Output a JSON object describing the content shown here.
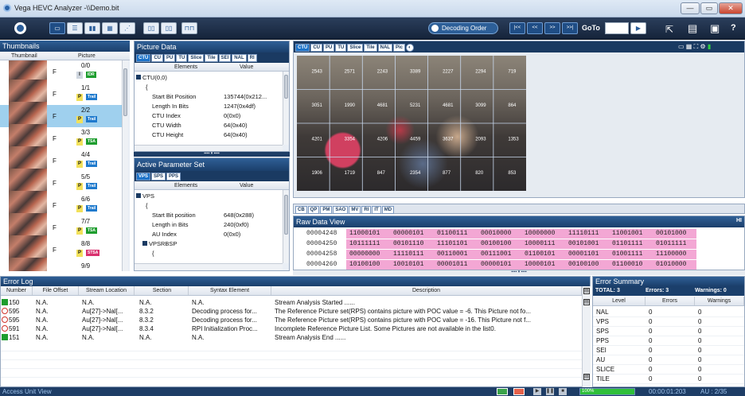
{
  "window": {
    "title": "Vega HEVC Analyzer -\\\\Demo.bit"
  },
  "toolbar": {
    "decoding_order": "Decoding Order",
    "nav": [
      "|<<",
      "<<",
      ">>",
      ">>|"
    ],
    "goto_label": "GoTo",
    "goto_value": ""
  },
  "thumbnails": {
    "title": "Thumbnails",
    "col_thumbnail": "Thumbnail",
    "col_picture": "Picture",
    "items": [
      {
        "type": "F",
        "poc": "0/0",
        "ptype": "I",
        "badge": "IDR",
        "badge_color": "#1e9d2e"
      },
      {
        "type": "F",
        "poc": "1/1",
        "ptype": "P",
        "badge": "Trail",
        "badge_color": "#1f7acd"
      },
      {
        "type": "F",
        "poc": "2/2",
        "ptype": "P",
        "badge": "Trail",
        "badge_color": "#1f7acd"
      },
      {
        "type": "F",
        "poc": "3/3",
        "ptype": "P",
        "badge": "TSA",
        "badge_color": "#1e9d2e"
      },
      {
        "type": "F",
        "poc": "4/4",
        "ptype": "P",
        "badge": "Trail",
        "badge_color": "#1f7acd"
      },
      {
        "type": "F",
        "poc": "5/5",
        "ptype": "P",
        "badge": "Trail",
        "badge_color": "#1f7acd"
      },
      {
        "type": "F",
        "poc": "6/6",
        "ptype": "P",
        "badge": "Trail",
        "badge_color": "#1f7acd"
      },
      {
        "type": "F",
        "poc": "7/7",
        "ptype": "P",
        "badge": "TSA",
        "badge_color": "#1e9d2e"
      },
      {
        "type": "F",
        "poc": "8/8",
        "ptype": "P",
        "badge": "STSA",
        "badge_color": "#d9306e"
      },
      {
        "type": "",
        "poc": "9/9",
        "ptype": "",
        "badge": "",
        "badge_color": ""
      }
    ]
  },
  "picture_data": {
    "title": "Picture Data",
    "tabs": [
      "CTU",
      "CU",
      "PU",
      "TU",
      "Slice",
      "Tile",
      "SEI",
      "NAL",
      "RI"
    ],
    "col_elements": "Elements",
    "col_value": "Value",
    "rows": [
      {
        "el": "CTU(0,0)",
        "val": "",
        "indent": 0,
        "box": true
      },
      {
        "el": "{",
        "val": "",
        "indent": 1
      },
      {
        "el": "Start Bit Position",
        "val": "135744(0x212...",
        "indent": 2
      },
      {
        "el": "Length In Bits",
        "val": "1247(0x4df)",
        "indent": 2
      },
      {
        "el": "CTU Index",
        "val": "0(0x0)",
        "indent": 2
      },
      {
        "el": "CTU Width",
        "val": "64(0x40)",
        "indent": 2
      },
      {
        "el": "CTU Height",
        "val": "64(0x40)",
        "indent": 2
      }
    ]
  },
  "active_param": {
    "title": "Active Parameter Set",
    "tabs": [
      "VPS",
      "SPS",
      "PPS"
    ],
    "col_elements": "Elements",
    "col_value": "Value",
    "rows": [
      {
        "el": "VPS",
        "val": "",
        "indent": 0,
        "box": true
      },
      {
        "el": "{",
        "val": "",
        "indent": 1
      },
      {
        "el": "Start Bit position",
        "val": "648(0x288)",
        "indent": 2
      },
      {
        "el": "Length in Bits",
        "val": "240(0xf0)",
        "indent": 2
      },
      {
        "el": "AU Index",
        "val": "0(0x0)",
        "indent": 2
      },
      {
        "el": "VPSRBSP",
        "val": "",
        "indent": 1,
        "box": true
      },
      {
        "el": "{",
        "val": "",
        "indent": 2
      }
    ]
  },
  "viewer": {
    "tabs": [
      "CTU",
      "CU",
      "PU",
      "TU",
      "Slice",
      "Tile",
      "NAL",
      "Pic"
    ],
    "cells": [
      [
        "2543",
        "2571",
        "2243",
        "3389",
        "2227",
        "2294",
        "719"
      ],
      [
        "3051",
        "1990",
        "4681",
        "5231",
        "4681",
        "3099",
        "864"
      ],
      [
        "4201",
        "3354",
        "4206",
        "4459",
        "3637",
        "2093",
        "1353"
      ],
      [
        "1906",
        "1719",
        "847",
        "2354",
        "877",
        "820",
        "853"
      ]
    ]
  },
  "lower_tabs": [
    "CB",
    "QP",
    "PM",
    "SAO",
    "MV",
    "RI",
    "IT",
    "MD"
  ],
  "raw": {
    "title": "Raw Data View",
    "hd_label": "HI",
    "rows": [
      {
        "addr": "00004248",
        "bytes": [
          "11000101",
          "00000101",
          "01100111",
          "00010000",
          "10000000",
          "11110111",
          "11001001",
          "00101000"
        ]
      },
      {
        "addr": "00004250",
        "bytes": [
          "10111111",
          "00101110",
          "11101101",
          "00100100",
          "10000111",
          "00101001",
          "01101111",
          "01011111"
        ]
      },
      {
        "addr": "00004258",
        "bytes": [
          "00000000",
          "11110111",
          "00110001",
          "00111001",
          "01100101",
          "00001101",
          "01001111",
          "11100000"
        ]
      },
      {
        "addr": "00004260",
        "bytes": [
          "10100100",
          "10010101",
          "00001011",
          "00000101",
          "10000101",
          "00100100",
          "01100010",
          "01010000"
        ]
      }
    ]
  },
  "error_log": {
    "title": "Error Log",
    "cols": [
      "Number",
      "File Offset",
      "Stream Location",
      "Section",
      "Syntax Element",
      "Description"
    ],
    "rows": [
      {
        "icon": "info",
        "num": "150",
        "off": "N.A.",
        "loc": "N.A.",
        "sec": "N.A.",
        "syn": "N.A.",
        "desc": "Stream Analysis Started ......"
      },
      {
        "icon": "error",
        "num": "595",
        "off": "N.A.",
        "loc": "Au[27]->Nal[...",
        "sec": "8.3.2",
        "syn": "Decoding process for...",
        "desc": "The Reference Picture set(RPS) contains picture with POC value = -6. This Picture not fo..."
      },
      {
        "icon": "error",
        "num": "595",
        "off": "N.A.",
        "loc": "Au[27]->Nal[...",
        "sec": "8.3.2",
        "syn": "Decoding process for...",
        "desc": "The Reference Picture set(RPS) contains picture with POC value = -16. This Picture not f..."
      },
      {
        "icon": "error",
        "num": "591",
        "off": "N.A.",
        "loc": "Au[27]->Nal[...",
        "sec": "8.3.4",
        "syn": "RPI Initialization Proc...",
        "desc": "Incomplete Reference Picture List. Some Pictures are not available in the list0."
      },
      {
        "icon": "info",
        "num": "151",
        "off": "N.A.",
        "loc": "N.A.",
        "sec": "N.A.",
        "syn": "N.A.",
        "desc": "Stream Analysis End ......"
      }
    ]
  },
  "error_summary": {
    "title": "Error Summary",
    "total": "TOTAL: 3",
    "errors": "Errors: 3",
    "warnings": "Warnings: 0",
    "cols": [
      "Level",
      "Errors",
      "Warnings"
    ],
    "rows": [
      {
        "level": "NAL",
        "errors": "0",
        "warnings": "0"
      },
      {
        "level": "VPS",
        "errors": "0",
        "warnings": "0"
      },
      {
        "level": "SPS",
        "errors": "0",
        "warnings": "0"
      },
      {
        "level": "PPS",
        "errors": "0",
        "warnings": "0"
      },
      {
        "level": "SEI",
        "errors": "0",
        "warnings": "0"
      },
      {
        "level": "AU",
        "errors": "0",
        "warnings": "0"
      },
      {
        "level": "SLICE",
        "errors": "0",
        "warnings": "0"
      },
      {
        "level": "TILE",
        "errors": "0",
        "warnings": "0"
      }
    ]
  },
  "status": {
    "left": "Access Unit View",
    "progress_label": "100%",
    "progress": 1.0,
    "time": "00:00:01:203",
    "au": "AU : 2/35"
  }
}
